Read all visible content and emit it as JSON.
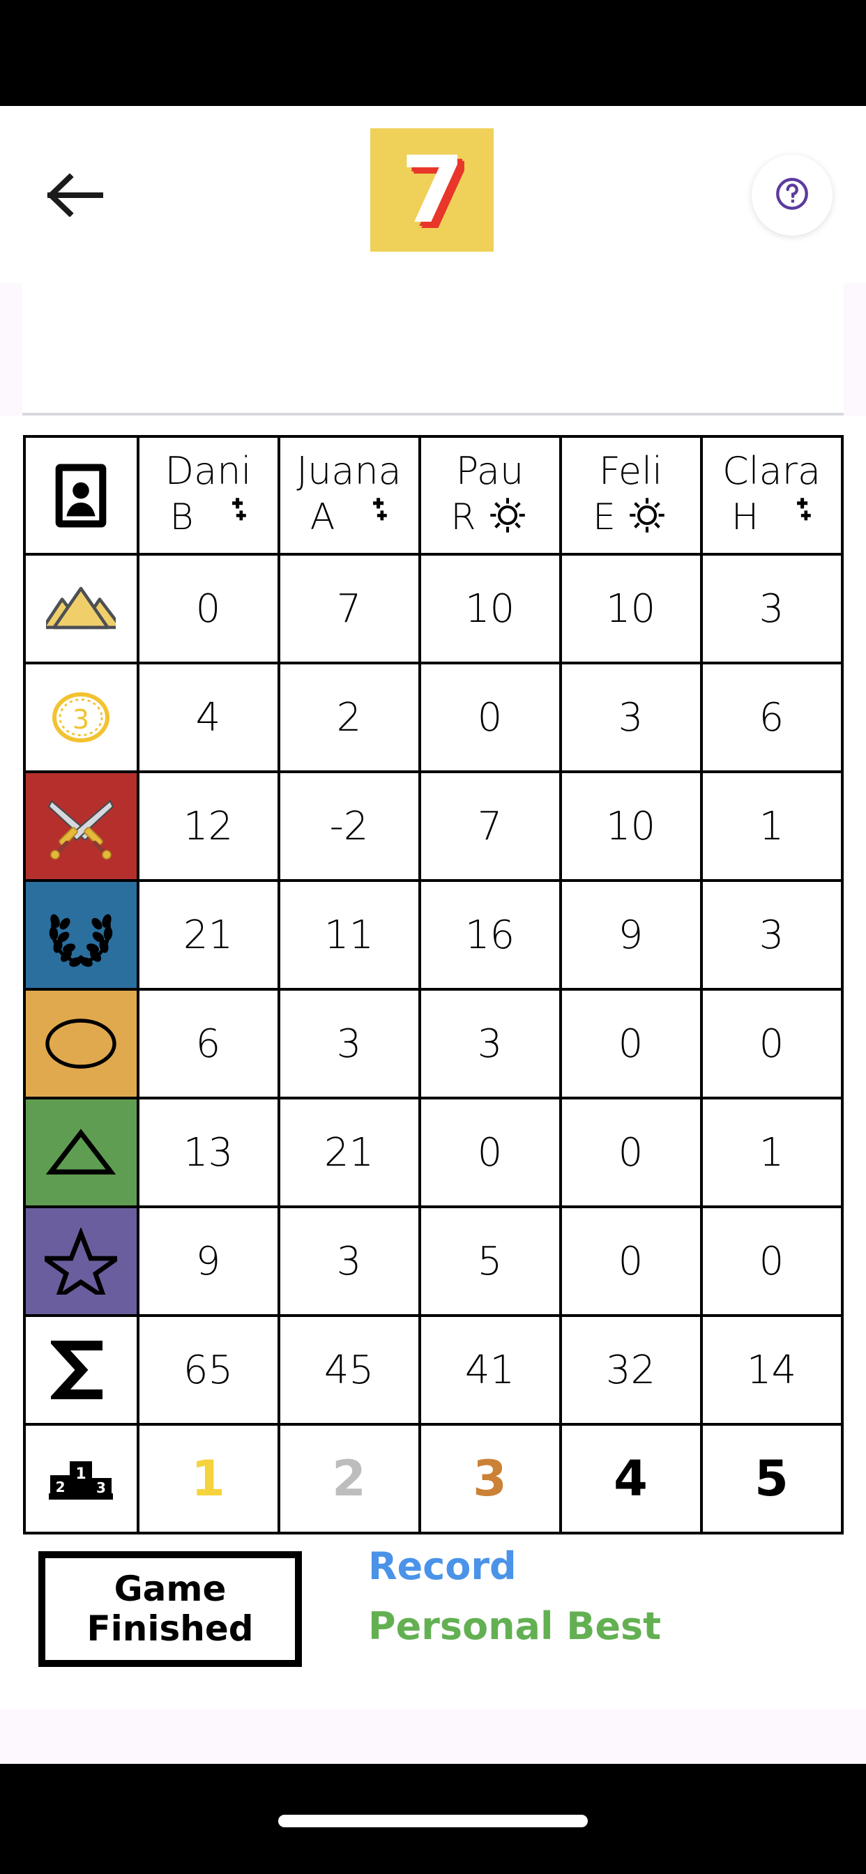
{
  "header": {
    "back_icon": "arrow-left-icon",
    "logo_text": "7",
    "logo_bg": "#efd159",
    "logo_shadow": "#e8362a",
    "help_icon": "question-circle-icon",
    "help_color": "#5b3a9e"
  },
  "table": {
    "row_header_icon": "portrait-frame-icon",
    "players": [
      {
        "name": "Dani",
        "letter": "B",
        "time_of_day": "moon-icon"
      },
      {
        "name": "Juana",
        "letter": "A",
        "time_of_day": "moon-icon"
      },
      {
        "name": "Pau",
        "letter": "R",
        "time_of_day": "sun-icon"
      },
      {
        "name": "Feli",
        "letter": "E",
        "time_of_day": "sun-icon"
      },
      {
        "name": "Clara",
        "letter": "H",
        "time_of_day": "moon-icon"
      }
    ],
    "rows": [
      {
        "icon": "pyramids-icon",
        "bg": "#ffffff",
        "values": [
          "0",
          "7",
          "10",
          "10",
          "3"
        ],
        "hl": [
          false,
          false,
          true,
          false,
          false
        ]
      },
      {
        "icon": "coin-3-icon",
        "bg": "#ffffff",
        "values": [
          "4",
          "2",
          "0",
          "3",
          "6"
        ],
        "hl": [
          true,
          false,
          false,
          true,
          false
        ]
      },
      {
        "icon": "swords-icon",
        "bg": "#b5302c",
        "values": [
          "12",
          "-2",
          "7",
          "10",
          "1"
        ],
        "hl": [
          true,
          false,
          false,
          true,
          false
        ]
      },
      {
        "icon": "laurel-icon",
        "bg": "#2a6f9e",
        "values": [
          "21",
          "11",
          "16",
          "9",
          "3"
        ],
        "hl": [
          true,
          false,
          false,
          false,
          false
        ]
      },
      {
        "icon": "circle-icon",
        "bg": "#e0a94e",
        "values": [
          "6",
          "3",
          "3",
          "0",
          "0"
        ],
        "hl": [
          false,
          false,
          true,
          false,
          false
        ]
      },
      {
        "icon": "triangle-icon",
        "bg": "#5f9e52",
        "values": [
          "13",
          "21",
          "0",
          "0",
          "1"
        ],
        "hl": [
          false,
          true,
          false,
          false,
          true
        ]
      },
      {
        "icon": "star-icon",
        "bg": "#6b5e9e",
        "values": [
          "9",
          "3",
          "5",
          "0",
          "0"
        ],
        "hl": [
          false,
          false,
          false,
          false,
          false
        ]
      },
      {
        "icon": "sigma-icon",
        "bg": "#ffffff",
        "values": [
          "65",
          "45",
          "41",
          "32",
          "14"
        ],
        "hl": [
          true,
          false,
          false,
          false,
          false
        ]
      }
    ],
    "rank_row": {
      "icon": "podium-icon",
      "values": [
        "1",
        "2",
        "3",
        "4",
        "5"
      ],
      "colors": [
        "#f5d33d",
        "#bdbdbd",
        "#cb8136",
        "#000000",
        "#000000"
      ]
    }
  },
  "legend": {
    "status_line1": "Game",
    "status_line2": "Finished",
    "record_label": "Record",
    "record_color": "#4a93e8",
    "personal_best_label": "Personal Best",
    "personal_best_color": "#63b053"
  }
}
